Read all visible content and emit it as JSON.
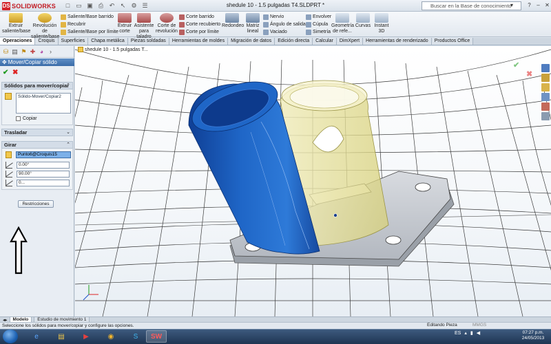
{
  "app": {
    "logo_text": "SOLIDWORKS",
    "logo_mark": "DS",
    "doc_title": "shedule 10 - 1.5 pulgadas T4.SLDPRT *",
    "search_placeholder": "Buscar en la Base de conocimiento",
    "search_button": "▾"
  },
  "ribbon": {
    "big_buttons": [
      {
        "label": "Extruir saliente/base"
      },
      {
        "label": "Revolución de saliente/base"
      },
      {
        "label": "Extruir corte"
      },
      {
        "label": "Asistente para taladro"
      },
      {
        "label": "Corte de revolución"
      },
      {
        "label": "Redondeo"
      },
      {
        "label": "Matriz lineal"
      },
      {
        "label": "Geometría de refe..."
      },
      {
        "label": "Curvas"
      },
      {
        "label": "Instant 3D"
      }
    ],
    "small_buttons": [
      {
        "label": "Saliente/Base barrido"
      },
      {
        "label": "Recubrir"
      },
      {
        "label": "Saliente/Base por límite"
      },
      {
        "label": "Corte barrido"
      },
      {
        "label": "Corte recubierto"
      },
      {
        "label": "Corte por límite"
      },
      {
        "label": "Nervio"
      },
      {
        "label": "Ángulo de salida"
      },
      {
        "label": "Vaciado"
      },
      {
        "label": "Envolver"
      },
      {
        "label": "Cúpula"
      },
      {
        "label": "Simetría"
      }
    ]
  },
  "tabs": [
    "Operaciones",
    "Croquis",
    "Superficies",
    "Chapa metálica",
    "Piezas soldadas",
    "Herramientas de moldes",
    "Migración de datos",
    "Edición directa",
    "Calcular",
    "DimXpert",
    "Herramientas de renderizado",
    "Productos Office"
  ],
  "property_manager": {
    "title": "Mover/Copiar sólido",
    "ok": "✔",
    "cancel": "✖",
    "bodies_group": "Sólidos para mover/copiar",
    "bodies_list_item": "Sólido-Mover/Copiar2",
    "copy_label": "Copiar",
    "translate_group": "Trasladar",
    "rotate_group": "Girar",
    "rotate_reference": "Punto6@Croquis15",
    "angles": [
      "0.00°",
      "90.00°",
      "0..."
    ],
    "constraints_button": "Restricciones"
  },
  "viewport": {
    "feature_tree_label": "shedule 10 - 1.5 pulgadas T...",
    "ok": "✔",
    "cancel": "✖"
  },
  "bottom_tabs": [
    "Modelo",
    "Estudio de movimiento 1"
  ],
  "status": {
    "message": "Seleccione los sólidos para mover/copiar y configure las opciones.",
    "mode": "Editando Pieza",
    "units": "MMGS"
  },
  "taskbar": {
    "language": "ES",
    "time": "07:27 p.m.",
    "date": "24/05/2013"
  },
  "colors": {
    "blue_tube": "#1e5fbf",
    "yellow_tube": "#e9e39a",
    "plate": "#c9ccd2",
    "grid": "#404040"
  }
}
